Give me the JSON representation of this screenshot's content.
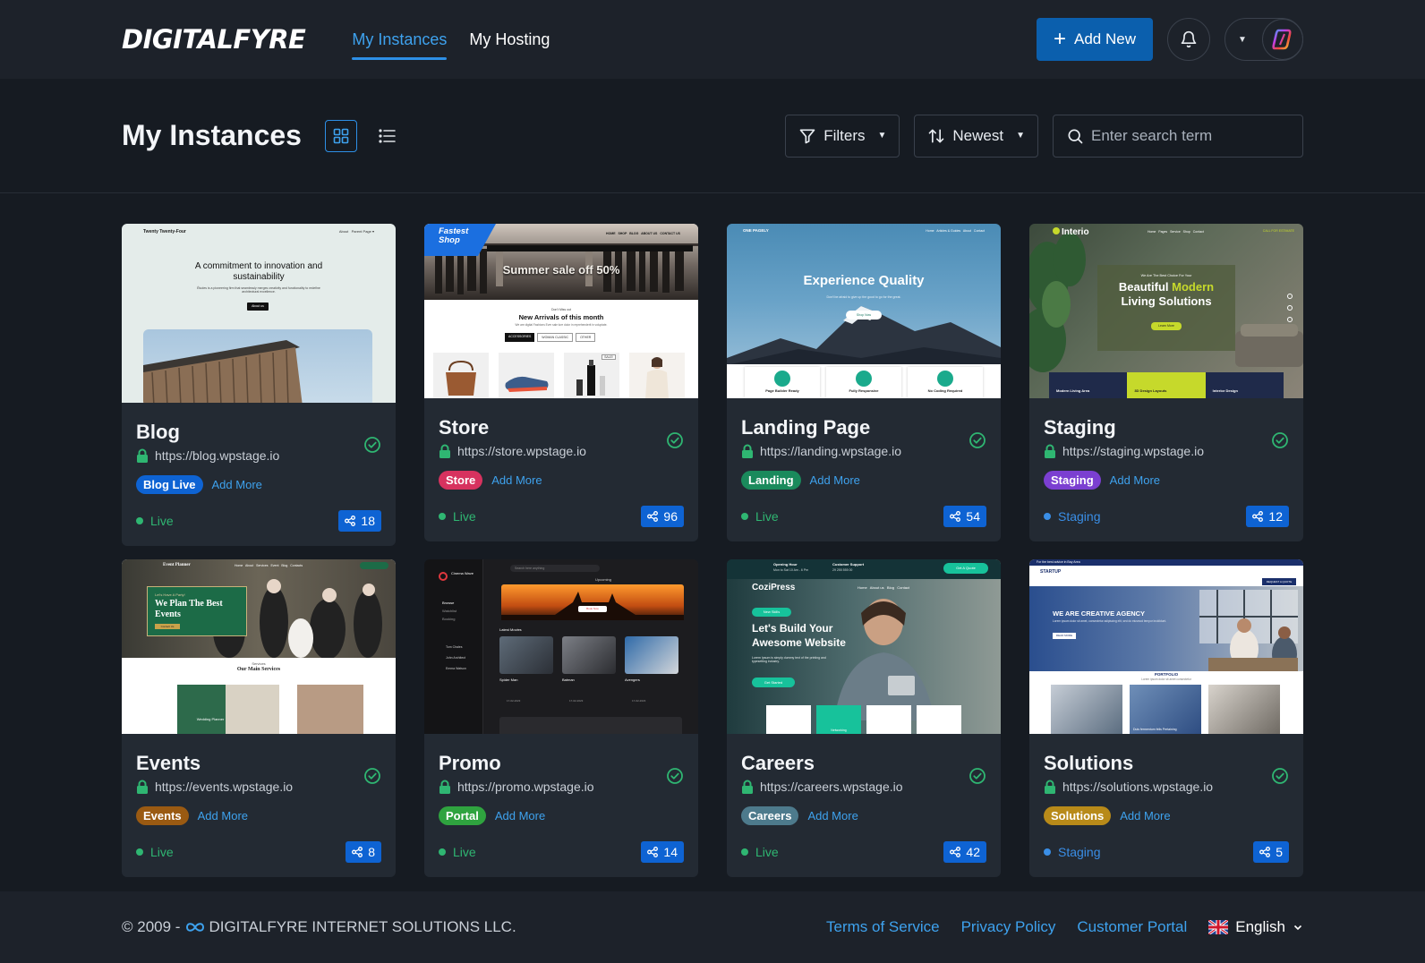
{
  "brand": {
    "logo": "DIGITALFYRE"
  },
  "nav": [
    {
      "label": "My Instances",
      "active": true
    },
    {
      "label": "My Hosting",
      "active": false
    }
  ],
  "header": {
    "add_new_label": "Add New",
    "bell_icon": "bell-icon",
    "accent": "#0b5fad"
  },
  "toolbar": {
    "title": "My Instances",
    "filters_label": "Filters",
    "sort_label": "Newest",
    "search_placeholder": "Enter search term"
  },
  "instances": [
    {
      "title": "Blog",
      "url": "https://blog.wpstage.io",
      "tag": "Blog Live",
      "tag_color": "#0e63d3",
      "add_more": "Add More",
      "status": "Live",
      "status_color": "#2fb672",
      "shares": "18",
      "thumb": {
        "brand": "Twenty Twenty-Four",
        "nav": "About   Parent Page ▾",
        "headline": "A commitment to innovation and sustainability",
        "sub": "Études is a pioneering firm that seamlessly merges creativity and functionality to redefine architectural excellence.",
        "cta": "About us"
      }
    },
    {
      "title": "Store",
      "url": "https://store.wpstage.io",
      "tag": "Store",
      "tag_color": "#d7325f",
      "add_more": "Add More",
      "status": "Live",
      "status_color": "#2fb672",
      "shares": "96",
      "thumb": {
        "ribbon": "Fastest Shop",
        "nav": "HOME   SHOP   BLOG   ABOUT US   CONTACT US",
        "headline": "Summer sale off 50%",
        "section_eyebrow": "Don't Miss out",
        "section_title": "New Arrivals of this month",
        "section_sub": "We are digital Fashions Ever sale lure dolor in reprehenderit in voluptate.",
        "tabs": [
          "ACCESSORIES",
          "WOMAN CLASSIC",
          "OTHER"
        ],
        "badge": "SALE!"
      }
    },
    {
      "title": "Landing Page",
      "url": "https://landing.wpstage.io",
      "tag": "Landing",
      "tag_color": "#1a8a5c",
      "add_more": "Add More",
      "status": "Live",
      "status_color": "#2fb672",
      "shares": "54",
      "thumb": {
        "brand": "ONE PAGELY",
        "nav": "Home   Articles & Guides   About   Contact",
        "headline": "Experience Quality",
        "sub": "Don't be afraid to give up the good to go for the great.",
        "cta": "Shop Now",
        "features": [
          "Page Builder Ready",
          "Fully Responsive",
          "No Coding Required"
        ]
      }
    },
    {
      "title": "Staging",
      "url": "https://staging.wpstage.io",
      "tag": "Staging",
      "tag_color": "#7b3fd1",
      "add_more": "Add More",
      "status": "Staging",
      "status_color": "#3a8ee6",
      "shares": "12",
      "thumb": {
        "brand": "Interio",
        "nav": "Home   Pages   Service   Shop   Contact",
        "phone": "CALL FOR ESTIMATE",
        "eyebrow": "We Are The Best Choice For Your",
        "headline_1": "Beautiful",
        "headline_accent": "Modern",
        "headline_2": "Living Solutions",
        "cta": "Learn More",
        "features": [
          "Modern Living Area",
          "3D Design Layouts",
          "Interior Design"
        ]
      }
    },
    {
      "title": "Events",
      "url": "https://events.wpstage.io",
      "tag": "Events",
      "tag_color": "#9a5a12",
      "add_more": "Add More",
      "status": "Live",
      "status_color": "#2fb672",
      "shares": "8",
      "thumb": {
        "brand": "Event Planner",
        "nav": "Home   About   Services   Event   Blog   Contacts",
        "eyebrow": "Let's Have A Party!",
        "headline": "We Plan The Best Events",
        "cta": "Contact Us",
        "section_eyebrow": "Services",
        "section_title": "Our Main Services",
        "card_label": "Wedding Planner"
      }
    },
    {
      "title": "Promo",
      "url": "https://promo.wpstage.io",
      "tag": "Portal",
      "tag_color": "#2fa33f",
      "add_more": "Add More",
      "status": "Live",
      "status_color": "#2fb672",
      "shares": "14",
      "thumb": {
        "brand": "Cinema Wave",
        "search": "Search here anything",
        "menu": [
          "Browse",
          "Watchlist",
          "Booking"
        ],
        "banner_label": "Upcoming",
        "banner_cta": "Book Now",
        "section": "Latest Movies",
        "movies": [
          "Spider Man",
          "Batman",
          "Avengers"
        ],
        "following": [
          "Tom Chales",
          "John Architect",
          "Emma Watson"
        ],
        "dates": [
          "17-02-2023",
          "17-02-2023",
          "17-02-2023"
        ]
      }
    },
    {
      "title": "Careers",
      "url": "https://careers.wpstage.io",
      "tag": "Careers",
      "tag_color": "#4d7a8c",
      "add_more": "Add More",
      "status": "Live",
      "status_color": "#2fb672",
      "shares": "42",
      "thumb": {
        "brand": "CoziPress",
        "hours": "Opening Hour",
        "hours_val": "Mon to Sat 10 Am - 6 Pm",
        "support": "Customer Support",
        "support_val": "29 255 555 00",
        "quote": "Get A Quote",
        "nav": "Home   About us   Blog   Contact",
        "eyebrow": "New Skills",
        "headline": "Let's Build Your Awesome Website",
        "sub": "Lorem Ipsum is simply dummy text of the printing and typesetting industry.",
        "cta": "Get Started",
        "tab": "Networking"
      }
    },
    {
      "title": "Solutions",
      "url": "https://solutions.wpstage.io",
      "tag": "Solutions",
      "tag_color": "#b88a19",
      "add_more": "Add More",
      "status": "Staging",
      "status_color": "#3a8ee6",
      "shares": "5",
      "thumb": {
        "brand": "STARTUP",
        "top": "For the best advice in Bay Area",
        "headline": "WE ARE CREATIVE AGENCY",
        "sub": "Lorem ipsum dolor sit amet, consectetur adipiscing elit, sed do eiusmod tempor incididunt.",
        "cta": "READ MORE",
        "quote_btn": "REQUEST A QUOTE",
        "section_eyebrow": "PORTFOLIO",
        "section_sub": "Lorem ipsum dolor sit amet consectetur",
        "caption": "Duis fermentum felis Pertaining"
      }
    }
  ],
  "footer": {
    "copyright_prefix": "© 2009 -",
    "company": "DIGITALFYRE INTERNET SOLUTIONS LLC.",
    "links": [
      "Terms of Service",
      "Privacy Policy",
      "Customer Portal"
    ],
    "language": "English"
  }
}
